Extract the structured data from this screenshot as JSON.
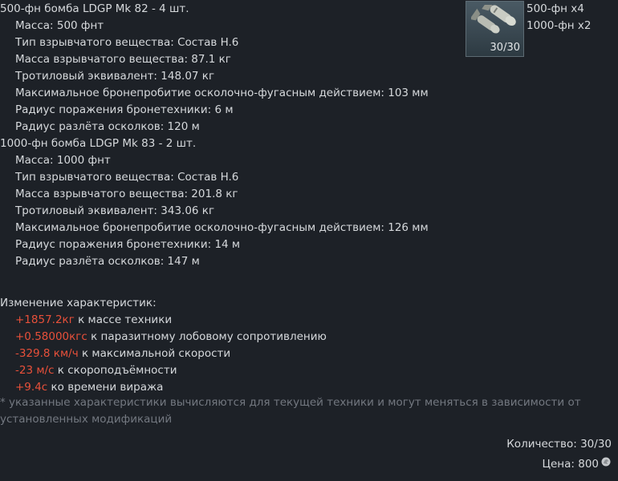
{
  "thumbnail": {
    "icon": "bombs-icon",
    "count": "30/30"
  },
  "loadout": [
    "500-фн x4",
    "1000-фн x2"
  ],
  "bombs": [
    {
      "title": "500-фн бомба LDGP Mk 82 - 4 шт.",
      "specs": [
        "Масса: 500 фнт",
        "Тип взрывчатого вещества: Состав H.6",
        "Масса взрывчатого вещества: 87.1 кг",
        "Тротиловый эквивалент: 148.07 кг",
        "Максимальное бронепробитие осколочно-фугасным действием: 103 мм",
        "Радиус поражения бронетехники: 6 м",
        "Радиус разлёта осколков: 120 м"
      ]
    },
    {
      "title": "1000-фн бомба LDGP Mk 83 - 2 шт.",
      "specs": [
        "Масса: 1000 фнт",
        "Тип взрывчатого вещества: Состав H.6",
        "Масса взрывчатого вещества: 201.8 кг",
        "Тротиловый эквивалент: 343.06 кг",
        "Максимальное бронепробитие осколочно-фугасным действием: 126 мм",
        "Радиус поражения бронетехники: 14 м",
        "Радиус разлёта осколков: 147 м"
      ]
    }
  ],
  "changes": {
    "header": "Изменение характеристик:",
    "items": [
      {
        "value": "+1857.2кг",
        "text": " к массе техники"
      },
      {
        "value": "+0.58000кгс",
        "text": " к паразитному лобовому сопротивлению"
      },
      {
        "value": "-329.8 км/ч",
        "text": " к максимальной скорости"
      },
      {
        "value": "-23 м/с",
        "text": " к скороподъёмности"
      },
      {
        "value": "+9.4с",
        "text": " ко времени виража"
      }
    ]
  },
  "note": "* указанные характеристики вычисляются для текущей техники и могут меняться в зависимости от установленных модификаций",
  "footer": {
    "quantity": "Количество: 30/30",
    "price": "Цена: 800",
    "price_icon": "silver-lions-icon"
  },
  "colors": {
    "background": "#1d2127",
    "text": "#d6d9dc",
    "negative_stat": "#e8503a",
    "note": "#737880"
  }
}
